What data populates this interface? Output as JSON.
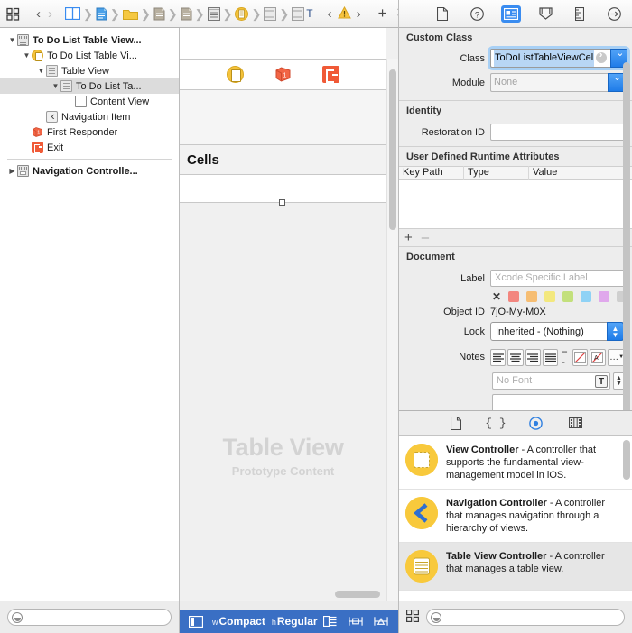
{
  "jumpbar": {
    "icons": [
      "grid-icon",
      "back-arrow",
      "forward-arrow",
      "assistant-editor-icon",
      "project-doc-icon",
      "folder-icon",
      "file-icon",
      "file2-icon",
      "storyboard-icon",
      "view-controller-icon",
      "table-view-icon",
      "cell-icon",
      "label-T-icon",
      "prev-issue-icon",
      "warning-icon",
      "next-issue-icon",
      "add-icon",
      "close-icon"
    ]
  },
  "outline": {
    "items": [
      {
        "label": "To Do List Table View...",
        "icon": "storyboard-scene-icon",
        "depth": 0,
        "disclosure": "open",
        "bold": true,
        "selected": false
      },
      {
        "label": "To Do List Table Vi...",
        "icon": "view-controller-icon",
        "depth": 1,
        "disclosure": "open",
        "bold": false,
        "selected": false
      },
      {
        "label": "Table View",
        "icon": "table-view-icon",
        "depth": 2,
        "disclosure": "open",
        "bold": false,
        "selected": false
      },
      {
        "label": "To Do List Ta...",
        "icon": "table-view-cell-icon",
        "depth": 3,
        "disclosure": "open",
        "bold": false,
        "selected": true
      },
      {
        "label": "Content View",
        "icon": "content-view-icon",
        "depth": 4,
        "disclosure": "none",
        "bold": false,
        "selected": false
      },
      {
        "label": "Navigation Item",
        "icon": "navigation-item-icon",
        "depth": 2,
        "disclosure": "none",
        "bold": false,
        "selected": false
      },
      {
        "label": "First Responder",
        "icon": "first-responder-icon",
        "depth": 1,
        "disclosure": "none",
        "bold": false,
        "selected": false
      },
      {
        "label": "Exit",
        "icon": "exit-icon",
        "depth": 1,
        "disclosure": "none",
        "bold": false,
        "selected": false
      }
    ],
    "items2": [
      {
        "label": "Navigation Controlle...",
        "icon": "navigation-controller-icon",
        "depth": 0,
        "disclosure": "closed",
        "bold": true,
        "selected": false
      }
    ],
    "filter_placeholder": ""
  },
  "canvas": {
    "cells_header": "Cells",
    "prototype_title": "Table View",
    "prototype_subtitle": "Prototype Content",
    "scene_icons": [
      "view-controller-icon",
      "first-responder-icon",
      "exit-icon"
    ]
  },
  "inspector": {
    "tabs": [
      {
        "name": "file-inspector-tab",
        "icon": "document-icon",
        "active": false
      },
      {
        "name": "quick-help-tab",
        "icon": "question-icon",
        "active": false
      },
      {
        "name": "identity-inspector-tab",
        "icon": "identity-card-icon",
        "active": true
      },
      {
        "name": "attributes-inspector-tab",
        "icon": "slider-down-icon",
        "active": false
      },
      {
        "name": "size-inspector-tab",
        "icon": "ruler-icon",
        "active": false
      },
      {
        "name": "connections-inspector-tab",
        "icon": "arrow-circle-icon",
        "active": false
      }
    ],
    "custom_class": {
      "title": "Custom Class",
      "class_label": "Class",
      "class_value": "ToDoListTableViewCel",
      "module_label": "Module",
      "module_value": "None"
    },
    "identity": {
      "title": "Identity",
      "restoration_id_label": "Restoration ID",
      "restoration_id_value": ""
    },
    "runtime_attributes": {
      "title": "User Defined Runtime Attributes",
      "columns": [
        "Key Path",
        "Type",
        "Value"
      ],
      "rows": [],
      "add_label": "+",
      "remove_label": "–"
    },
    "document": {
      "title": "Document",
      "label_label": "Label",
      "label_placeholder": "Xcode Specific Label",
      "swatch_colors": [
        "#f3867f",
        "#f6bd72",
        "#f3e87e",
        "#c3e07c",
        "#8fd2f5",
        "#e0a8ec",
        "#cfcfcf"
      ],
      "swatch_clear": "✕",
      "object_id_label": "Object ID",
      "object_id_value": "7jO-My-M0X",
      "lock_label": "Lock",
      "lock_value": "Inherited - (Nothing)",
      "notes_label": "Notes",
      "notes_buttons": [
        "align-left-icon",
        "align-center-icon",
        "align-right-icon",
        "align-justify-icon",
        "dash-icon",
        "text-color-icon",
        "highlight-color-icon",
        "more-icon"
      ],
      "font_placeholder": "No Font",
      "font_button": "T",
      "notes_value": ""
    }
  },
  "library": {
    "tabs": [
      {
        "name": "file-template-library-tab",
        "icon": "document-icon",
        "active": false
      },
      {
        "name": "code-snippet-library-tab",
        "icon": "braces-icon",
        "active": false
      },
      {
        "name": "object-library-tab",
        "icon": "circle-dot-icon",
        "active": true
      },
      {
        "name": "media-library-tab",
        "icon": "filmstrip-icon",
        "active": false
      }
    ],
    "items": [
      {
        "title": "View Controller",
        "desc": " - A controller that supports the fundamental view-management model in iOS.",
        "icon": "view-controller-lib-icon",
        "selected": false
      },
      {
        "title": "Navigation Controller",
        "desc": " - A controller that manages navigation through a hierarchy of views.",
        "icon": "navigation-controller-lib-icon",
        "selected": false
      },
      {
        "title": "Table View Controller",
        "desc": " - A controller that manages a table view.",
        "icon": "table-view-controller-lib-icon",
        "selected": true
      }
    ]
  },
  "statusbar": {
    "w_prefix": "w",
    "w_value": "Compact",
    "h_prefix": "h",
    "h_value": "Regular",
    "icons": [
      "device-icon",
      "variations-icon",
      "horizontal-fit-icon",
      "vertical-fit-icon"
    ],
    "library_filter_placeholder": ""
  },
  "colors": {
    "accent_blue": "#3a8cf0",
    "status_blue": "#3a6fc4",
    "selection_gray": "#dcdcdc",
    "yellow": "#f8c93c",
    "orange_red": "#f05a37"
  }
}
